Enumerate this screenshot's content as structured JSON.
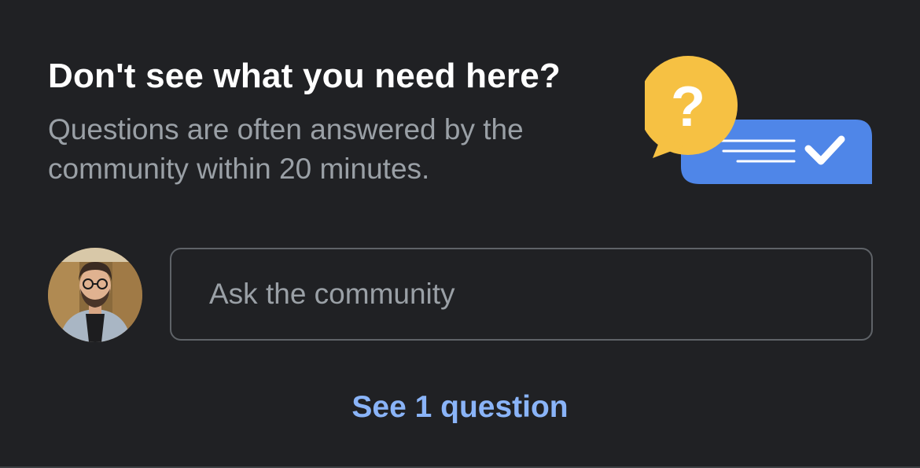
{
  "header": {
    "title": "Don't see what you need here?",
    "subtitle": "Questions are often answered by the community within 20 minutes."
  },
  "illustration": {
    "question_glyph": "?",
    "question_color": "#f6c143",
    "answer_color": "#4f86e8",
    "icons": [
      "question-bubble-icon",
      "answer-bubble-icon",
      "checkmark-icon"
    ]
  },
  "ask": {
    "placeholder": "Ask the community"
  },
  "footer": {
    "see_questions_label": "See 1 question",
    "link_color": "#8ab4f8"
  }
}
